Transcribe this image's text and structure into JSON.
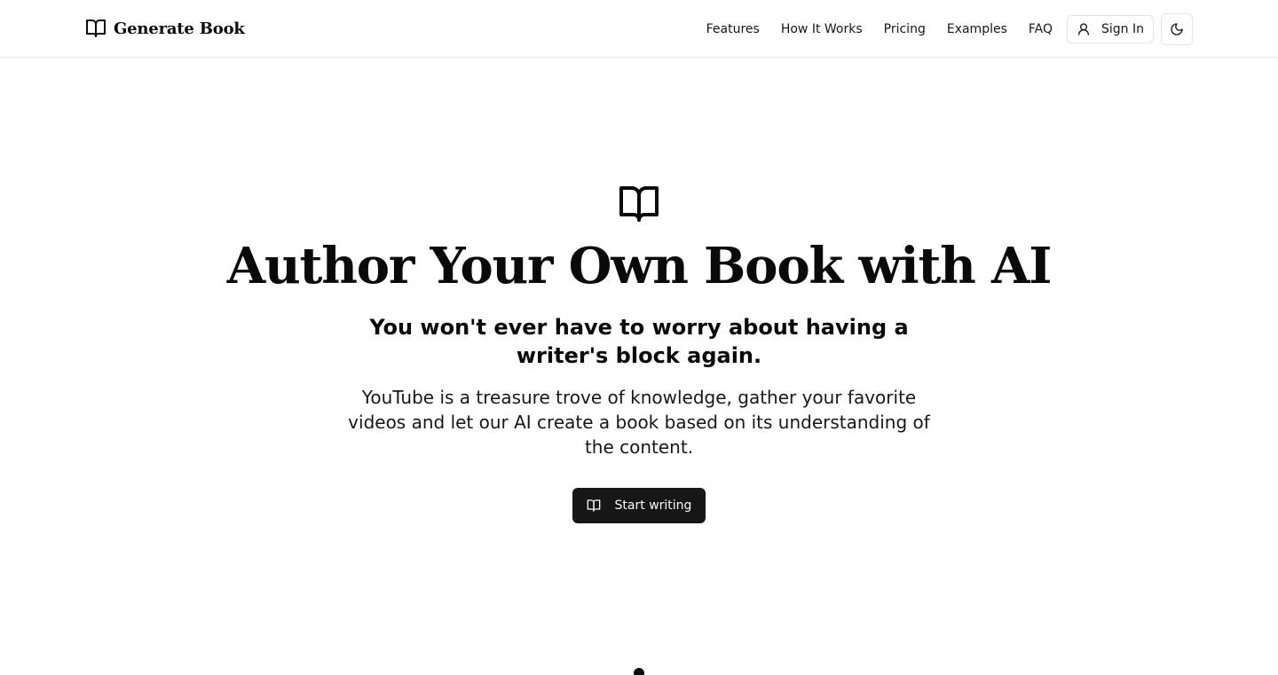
{
  "header": {
    "brand_name": "Generate Book",
    "brand_icon": "book-open-icon",
    "nav": [
      {
        "label": "Features"
      },
      {
        "label": "How It Works"
      },
      {
        "label": "Pricing"
      },
      {
        "label": "Examples"
      },
      {
        "label": "FAQ"
      }
    ],
    "sign_in_label": "Sign In",
    "sign_in_icon": "user-icon",
    "theme_toggle_icon": "moon-icon"
  },
  "hero": {
    "icon": "book-open-icon",
    "title": "Author Your Own Book with AI",
    "subtitle": "You won't ever have to worry about having a writer's block again.",
    "description": "YouTube is a treasure trove of knowledge, gather your favorite videos and let our AI create a book based on its understanding of the content.",
    "cta_label": "Start writing",
    "cta_icon": "book-open-icon"
  },
  "colors": {
    "background": "#ffffff",
    "text": "#0a0a0a",
    "border": "#e5e5e5",
    "primary_button": "#171717",
    "primary_button_text": "#fafafa"
  }
}
